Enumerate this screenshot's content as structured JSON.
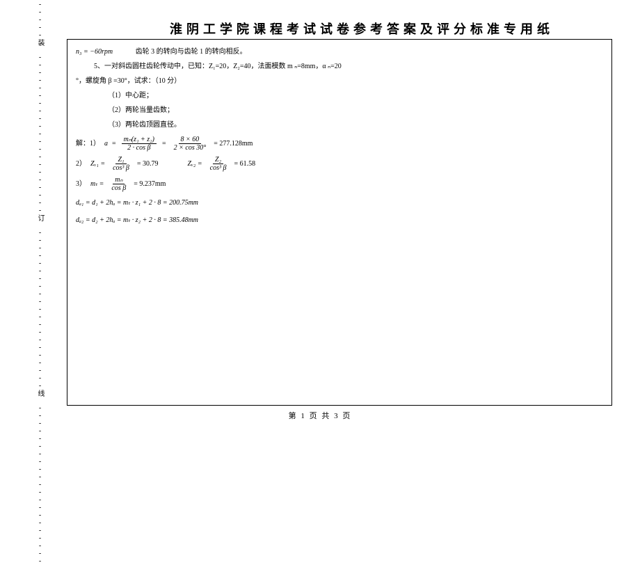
{
  "header": {
    "title": "淮阴工学院课程考试试卷参考答案及评分标准专用纸"
  },
  "side": {
    "text": "---------------------装 ---------------------订 ---------------------线 ---------------------"
  },
  "content": {
    "n3": "n₃ = −60rpm",
    "n3_note": "齿轮 3 的转向与齿轮 1 的转向相反。",
    "q5_a": "5、一对斜齿圆柱齿轮传动中，已知：Z₁=20，Z₂=40，法面模数 m ₙ=8mm，α ₙ=20",
    "q5_b": "°，螺旋角 β =30°，试求：（10 分）",
    "q5_1": "（1）中心距；",
    "q5_2": "（2）两轮当量齿数；",
    "q5_3": "（3）两轮齿顶圆直径。",
    "sol_label": "解：1）",
    "eq_a_lhs": "a",
    "eq_a_f1_num": "mₙ(z₁ + z₂)",
    "eq_a_f1_den": "2 · cos β",
    "eq_a_f2_num": "8 × 60",
    "eq_a_f2_den": "2 × cos 30°",
    "eq_a_res": "= 277.128mm",
    "sol2_label": "2）",
    "eq_zv1_lhs": "Zᵥ₁ =",
    "eq_zv1_num": "Z₁",
    "eq_zv1_den": "cos³ β",
    "eq_zv1_res": "= 30.79",
    "eq_zv2_lhs": "Zᵥ₂ =",
    "eq_zv2_num": "Z₂",
    "eq_zv2_den": "cos³ β",
    "eq_zv2_res": "= 61.58",
    "sol3_label": "3）",
    "eq_mt_lhs": "mₜ =",
    "eq_mt_num": "mₙ",
    "eq_mt_den": "cos β",
    "eq_mt_res": "= 9.237mm",
    "eq_da1": "dₐ₁ = d₁ + 2hₐ = mₜ · z₁ + 2 · 8 = 200.75mm",
    "eq_da2": "dₐ₂ = d₂ + 2hₐ = mₜ · z₂ + 2 · 8 = 385.48mm"
  },
  "footer": {
    "text": "第 1 页   共 3 页"
  }
}
